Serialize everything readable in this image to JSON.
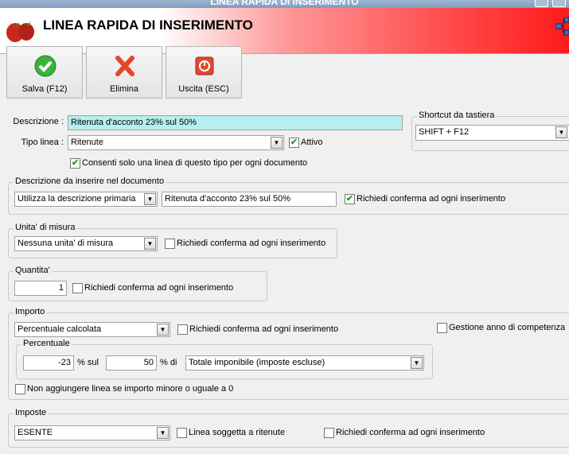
{
  "window": {
    "title": "LINEA RAPIDA DI INSERIMENTO"
  },
  "header": {
    "title": "LINEA RAPIDA DI INSERIMENTO",
    "logo": "strawberry-icon",
    "right_icon": "network-icon"
  },
  "toolbar": {
    "save": "Salva (F12)",
    "delete": "Elimina",
    "exit": "Uscita (ESC)"
  },
  "form": {
    "descrizione_label": "Descrizione :",
    "descrizione_value": "Ritenuta d'acconto 23% sul 50%",
    "tipo_label": "Tipo linea :",
    "tipo_value": "Ritenute",
    "attivo_label": "Attivo",
    "attivo_checked": true,
    "consenti_label": "Consenti solo una linea di questo tipo per ogni documento",
    "consenti_checked": true
  },
  "shortcut": {
    "title": "Shortcut da tastiera",
    "value": "SHIFT + F12"
  },
  "desc_doc": {
    "title": "Descrizione da inserire nel documento",
    "mode": "Utilizza la descrizione primaria",
    "text": "Ritenuta d'acconto 23% sul 50%",
    "confirm_label": "Richiedi conferma ad ogni inserimento",
    "confirm_checked": true
  },
  "unita": {
    "title": "Unita' di misura",
    "value": "Nessuna unita' di misura",
    "confirm_label": "Richiedi conferma ad ogni inserimento",
    "confirm_checked": false
  },
  "quantita": {
    "title": "Quantita'",
    "value": "1",
    "confirm_label": "Richiedi conferma ad ogni inserimento",
    "confirm_checked": false
  },
  "importo": {
    "title": "Importo",
    "mode": "Percentuale calcolata",
    "confirm_label": "Richiedi conferma ad ogni inserimento",
    "gestione_label": "Gestione anno di competenza",
    "percentuale": {
      "title": "Percentuale",
      "value": "-23",
      "sul_label": "% sul",
      "base": "50",
      "di_label": "% di",
      "base_type": "Totale imponibile (imposte escluse)"
    },
    "non_aggiungere_label": "Non aggiungere linea se importo minore o uguale a 0"
  },
  "imposte": {
    "title": "Imposte",
    "value": "ESENTE",
    "ritenute_label": "Linea soggetta a ritenute",
    "confirm_label": "Richiedi conferma ad ogni inserimento"
  },
  "check_mark": "✔",
  "dropdown_arrow": "▼"
}
